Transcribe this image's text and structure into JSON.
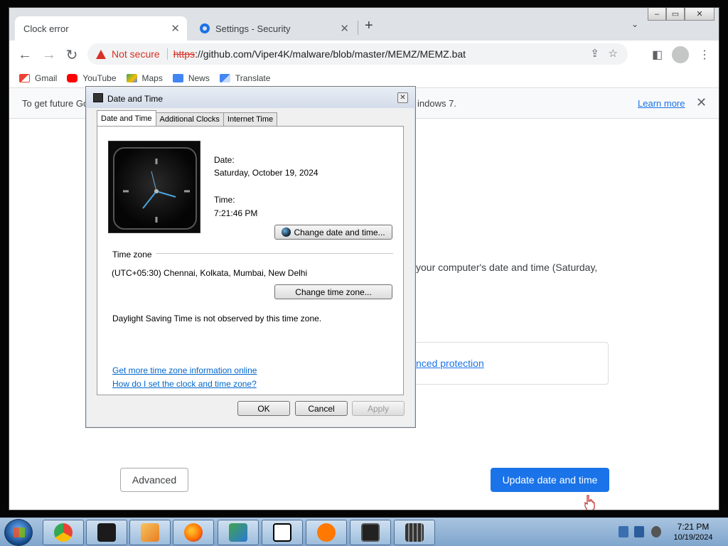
{
  "browser": {
    "tabs": [
      {
        "label": "Clock error"
      },
      {
        "label": "Settings - Security"
      }
    ],
    "url": {
      "security_label": "Not secure",
      "scheme": "https",
      "rest": "://github.com/Viper4K/malware/blob/master/MEMZ/MEMZ.bat"
    },
    "bookmarks": [
      {
        "label": "Gmail"
      },
      {
        "label": "YouTube"
      },
      {
        "label": "Maps"
      },
      {
        "label": "News"
      },
      {
        "label": "Translate"
      }
    ],
    "infobar": {
      "lead": "To get future Go",
      "tail": "indows 7.",
      "learn_more": "Learn more"
    }
  },
  "page": {
    "body_text": "your computer's date and time (Saturday,",
    "protection_link": "nced protection",
    "advanced_button": "Advanced",
    "update_button": "Update date and time"
  },
  "dialog": {
    "title": "Date and Time",
    "tabs": [
      {
        "label": "Date and Time"
      },
      {
        "label": "Additional Clocks"
      },
      {
        "label": "Internet Time"
      }
    ],
    "date_label": "Date:",
    "date_value": "Saturday, October 19, 2024",
    "time_label": "Time:",
    "time_value": "7:21:46 PM",
    "change_datetime_button": "Change date and time...",
    "timezone_heading": "Time zone",
    "timezone_value": "(UTC+05:30) Chennai, Kolkata, Mumbai, New Delhi",
    "change_timezone_button": "Change time zone...",
    "dst_note": "Daylight Saving Time is not observed by this time zone.",
    "link_more_info": "Get more time zone information online",
    "link_how_to": "How do I set the clock and time zone?",
    "ok_button": "OK",
    "cancel_button": "Cancel",
    "apply_button": "Apply"
  },
  "taskbar": {
    "clock_time": "7:21 PM",
    "clock_date": "10/19/2024",
    "apps": [
      "chrome-icon",
      "terminal-icon",
      "media-player-icon",
      "firefox-icon",
      "network-icon",
      "7zip-icon",
      "avast-icon",
      "monitor-icon",
      "calculator-icon"
    ]
  },
  "colors": {
    "accent": "#1a73e8",
    "danger": "#d93025",
    "link": "#0066cc"
  }
}
